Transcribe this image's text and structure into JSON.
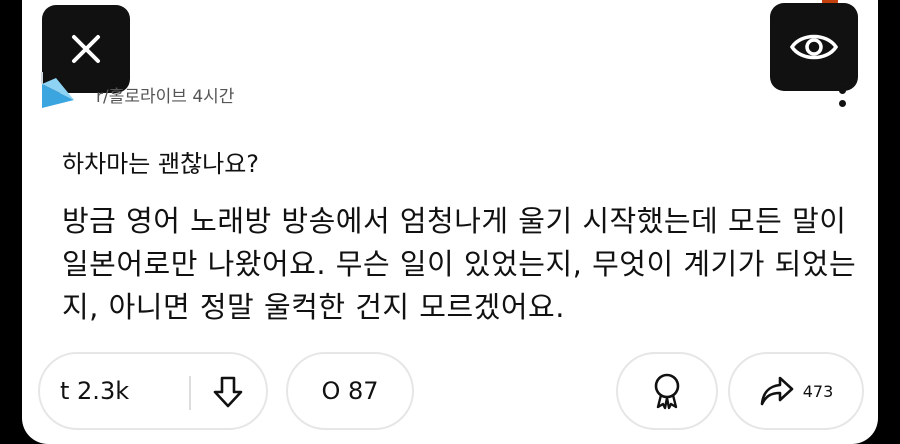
{
  "post": {
    "meta": "r/홀로라이브 4시간",
    "title": "하차마는 괜찮나요?",
    "body": "방금 영어 노래방 방송에서 엄청나게 울기 시작했는데 모든 말이 일본어로만 나왔어요. 무슨 일이 있었는지, 무엇이 계기가 되었는지, 아니면 정말 울컥한 건지 모르겠어요."
  },
  "actions": {
    "upvotes": "t 2.3k",
    "comments": "O 87",
    "shares": "473"
  },
  "icons": {
    "close": "close-icon",
    "view": "eye-icon",
    "more": "more-vertical-icon",
    "downvote": "downvote-arrow-icon",
    "award": "award-icon",
    "share": "share-arrow-icon"
  }
}
